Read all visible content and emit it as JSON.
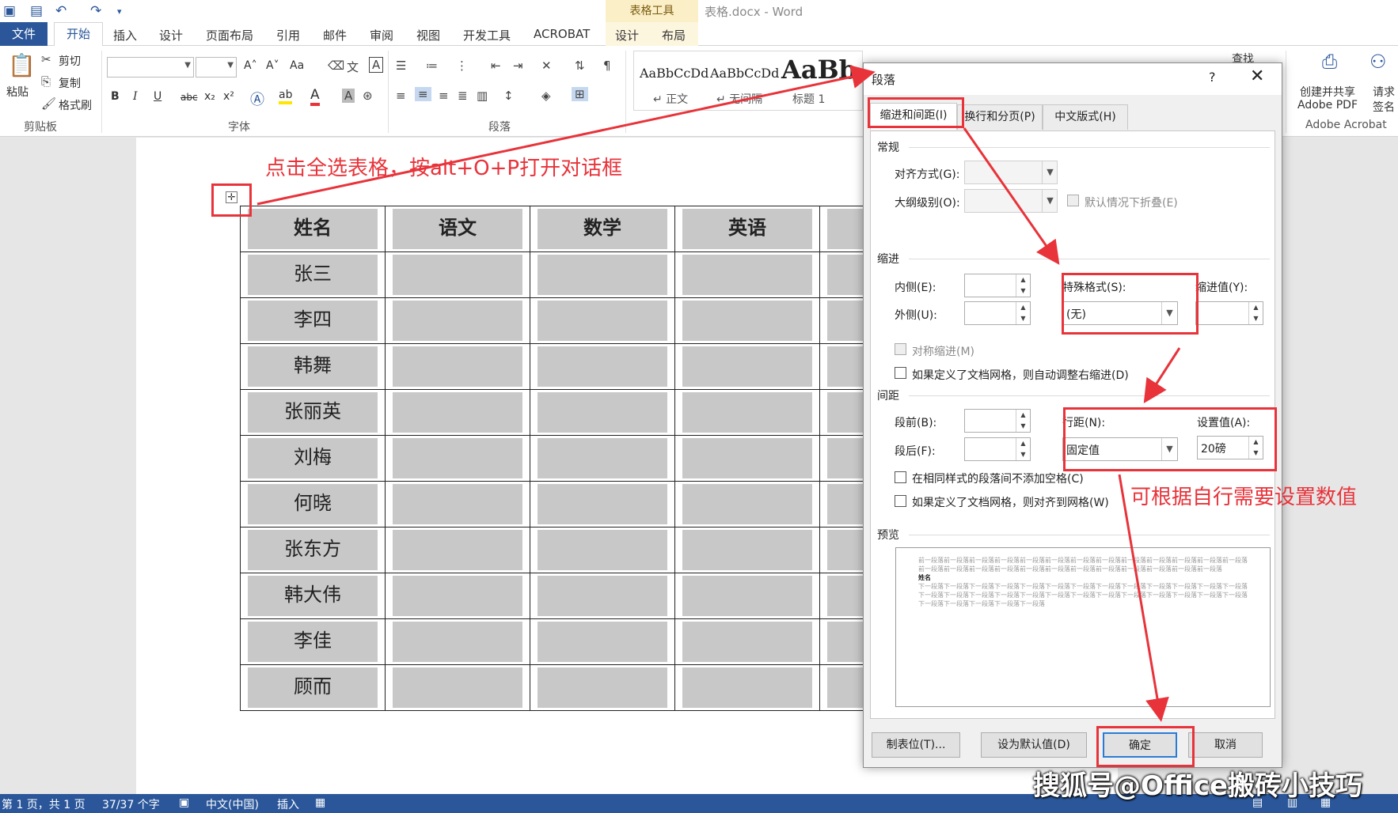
{
  "titlebar": {
    "context_label": "表格工具",
    "doc_title": "表格.docx - Word"
  },
  "tabs": {
    "file": "文件",
    "home": "开始",
    "insert": "插入",
    "design": "设计",
    "layout": "页面布局",
    "references": "引用",
    "mailings": "邮件",
    "review": "审阅",
    "view": "视图",
    "developer": "开发工具",
    "acrobat": "ACROBAT",
    "table_design": "设计",
    "table_layout": "布局"
  },
  "ribbon": {
    "clipboard": {
      "paste": "粘贴",
      "cut": "剪切",
      "copy": "复制",
      "format_painter": "格式刷",
      "label": "剪贴板"
    },
    "font": {
      "label": "字体",
      "bold": "B",
      "italic": "I",
      "underline": "U",
      "strike": "abc",
      "sub": "x₂",
      "sup": "x²",
      "grow": "A˄",
      "shrink": "A˅",
      "case": "Aa",
      "highlight_letter": "ab",
      "font_color_letter": "A"
    },
    "paragraph": {
      "label": "段落"
    },
    "styles": {
      "items": [
        {
          "sample": "AaBbCcDd",
          "name": "↵ 正文"
        },
        {
          "sample": "AaBbCcDd",
          "name": "↵ 无间隔"
        },
        {
          "sample": "AaBb",
          "name": "标题 1"
        }
      ]
    },
    "find": "查找",
    "acrobat": {
      "create_share_1": "创建并共享",
      "create_share_2": "Adobe PDF",
      "request_sign_1": "请求",
      "request_sign_2": "签名",
      "label": "Adobe Acrobat"
    }
  },
  "annotations": {
    "top": "点击全选表格，按alt+O+P打开对话框",
    "right": "可根据自行需要设置数值"
  },
  "table": {
    "headers": [
      "姓名",
      "语文",
      "数学",
      "英语",
      ""
    ],
    "names": [
      "张三",
      "李四",
      "韩舞",
      "张丽英",
      "刘梅",
      "何晓",
      "张东方",
      "韩大伟",
      "李佳",
      "顾而"
    ]
  },
  "dialog": {
    "title": "段落",
    "help": "?",
    "close": "✕",
    "tabs": [
      "缩进和间距(I)",
      "换行和分页(P)",
      "中文版式(H)"
    ],
    "general": {
      "title": "常规",
      "align_label": "对齐方式(G):",
      "align_value": "",
      "outline_label": "大纲级别(O):",
      "outline_value": "",
      "collapse_label": "默认情况下折叠(E)"
    },
    "indent": {
      "title": "缩进",
      "inside_label": "内侧(E):",
      "inside_value": "",
      "outside_label": "外侧(U):",
      "outside_value": "",
      "special_label": "特殊格式(S):",
      "special_value": "(无)",
      "by_label": "缩进值(Y):",
      "by_value": "",
      "mirror_label": "对称缩进(M)",
      "auto_adjust_label": "如果定义了文档网格，则自动调整右缩进(D)"
    },
    "spacing": {
      "title": "间距",
      "before_label": "段前(B):",
      "before_value": "",
      "after_label": "段后(F):",
      "after_value": "",
      "line_label": "行距(N):",
      "line_value": "固定值",
      "at_label": "设置值(A):",
      "at_value": "20磅",
      "no_space_label": "在相同样式的段落间不添加空格(C)",
      "snap_grid_label": "如果定义了文档网格，则对齐到网格(W)"
    },
    "preview": {
      "title": "预览",
      "prev_text": "前一段落前一段落前一段落前一段落前一段落前一段落前一段落前一段落前一段落前一段落前一段落前一段落前一段落前一段落前一段落前一段落前一段落前一段落前一段落前一段落前一段落前一段落前一段落前一段落前一段落",
      "sample_text": "姓名",
      "next_text": "下一段落下一段落下一段落下一段落下一段落下一段落下一段落下一段落下一段落下一段落下一段落下一段落下一段落下一段落下一段落下一段落下一段落下一段落下一段落下一段落下一段落下一段落下一段落下一段落下一段落下一段落下一段落下一段落下一段落下一段落下一段落"
    },
    "buttons": {
      "tabs": "制表位(T)...",
      "default": "设为默认值(D)",
      "ok": "确定",
      "cancel": "取消"
    }
  },
  "statusbar": {
    "page": "第 1 页，共 1 页",
    "words": "37/37 个字",
    "language": "中文(中国)",
    "mode": "插入"
  },
  "watermark": "搜狐号@Office搬砖小技巧",
  "colors": {
    "accent": "#2b579a",
    "annotation": "#e8333a",
    "cell_shading": "#c8c8c8"
  }
}
